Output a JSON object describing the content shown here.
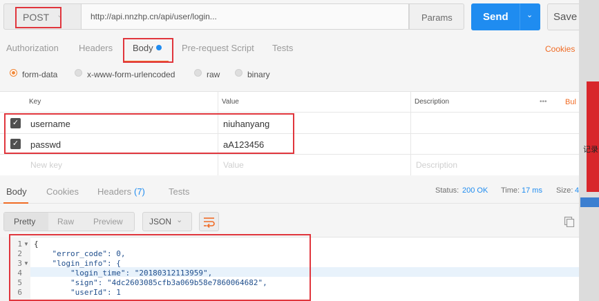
{
  "request": {
    "method": "POST",
    "url": "http://api.nnzhp.cn/api/user/login...",
    "params_label": "Params",
    "send_label": "Send",
    "save_label": "Save"
  },
  "request_tabs": [
    "Authorization",
    "Headers",
    "Body",
    "Pre-request Script",
    "Tests"
  ],
  "cookies_label": "Cookies",
  "body_types": [
    "form-data",
    "x-www-form-urlencoded",
    "raw",
    "binary"
  ],
  "body_type_selected": "form-data",
  "params_table": {
    "headers": [
      "Key",
      "Value",
      "Description"
    ],
    "more_label": "•••",
    "bulk_label": "Bul",
    "rows": [
      {
        "key": "username",
        "value": "niuhanyang",
        "checked": true
      },
      {
        "key": "passwd",
        "value": "aA123456",
        "checked": true
      }
    ],
    "placeholder": {
      "key": "New key",
      "value": "Value",
      "description": "Description"
    }
  },
  "response_tabs": {
    "body": "Body",
    "cookies": "Cookies",
    "headers": "Headers",
    "headers_count": "(7)",
    "tests": "Tests"
  },
  "status": {
    "status_label": "Status:",
    "status_value": "200 OK",
    "time_label": "Time:",
    "time_value": "17 ms",
    "size_label": "Size:",
    "size_value": "4"
  },
  "view_modes": [
    "Pretty",
    "Raw",
    "Preview"
  ],
  "format": "JSON",
  "code_lines": [
    "{",
    "    \"error_code\": 0,",
    "    \"login_info\": {",
    "        \"login_time\": \"20180312113959\",",
    "        \"sign\": \"4dc2603085cfb3a069b58e7860064682\",",
    "        \"userId\": 1"
  ],
  "side_window_text": "记录"
}
